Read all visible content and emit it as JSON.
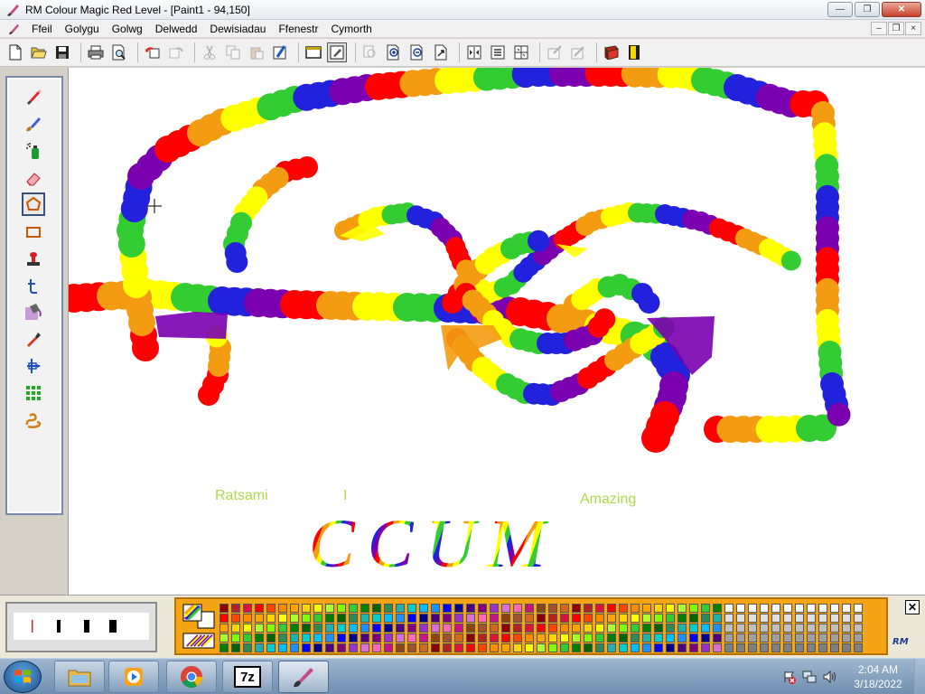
{
  "window": {
    "title": "RM Colour Magic  Red Level  - [Paint1 - 94,150]",
    "caption_buttons": {
      "minimize": "—",
      "maximize": "❐",
      "close": "✕"
    }
  },
  "menu": {
    "items": [
      "Ffeil",
      "Golygu",
      "Golwg",
      "Delwedd",
      "Dewisiadau",
      "Ffenestr",
      "Cymorth"
    ],
    "mdi_buttons": {
      "minimize": "–",
      "restore": "❐",
      "close": "×"
    }
  },
  "toolbar": {
    "buttons": [
      "new-icon",
      "open-icon",
      "save-icon",
      "print-icon",
      "print-preview-icon",
      "undo-icon",
      "redo-icon",
      "cut-icon",
      "copy-icon",
      "paste-icon",
      "clear-icon",
      "full-view-icon",
      "edit-view-icon",
      "zoom-icon",
      "zoom-in-icon",
      "zoom-out-icon",
      "zoom-fit-icon",
      "flip-icon",
      "rotate-icon",
      "grid-icon",
      "filter-icon",
      "effects-icon",
      "help-book-icon",
      "exit-icon"
    ]
  },
  "tools": [
    {
      "name": "pencil-icon",
      "selected": false
    },
    {
      "name": "brush-icon",
      "selected": false
    },
    {
      "name": "spray-icon",
      "selected": false
    },
    {
      "name": "eraser-icon",
      "selected": false
    },
    {
      "name": "polygon-icon",
      "selected": true
    },
    {
      "name": "rectangle-icon",
      "selected": false
    },
    {
      "name": "stamp-icon",
      "selected": false
    },
    {
      "name": "text-icon",
      "selected": false
    },
    {
      "name": "fill-icon",
      "selected": false
    },
    {
      "name": "picker-icon",
      "selected": false
    },
    {
      "name": "move-icon",
      "selected": false
    },
    {
      "name": "pattern-icon",
      "selected": false
    },
    {
      "name": "rope-icon",
      "selected": false
    }
  ],
  "canvas": {
    "text_fragments": [
      "Ratsami",
      "I",
      "Amazing"
    ],
    "big_text": "CCUM"
  },
  "bottom_panel": {
    "close_label": "✕",
    "logo": "RM"
  },
  "taskbar": {
    "apps": [
      "explorer-icon",
      "media-player-icon",
      "chrome-icon",
      "7zip-icon",
      "colour-magic-icon"
    ],
    "sevenzip_label": "7z",
    "clock": {
      "time": "2:04 AM",
      "date": "3/18/2022"
    }
  },
  "colors": {
    "rainbow": [
      "#ff0000",
      "#f39c12",
      "#ffff00",
      "#33cc33",
      "#2222dd",
      "#7a00b0"
    ],
    "palette_frame": "#f5a415"
  }
}
